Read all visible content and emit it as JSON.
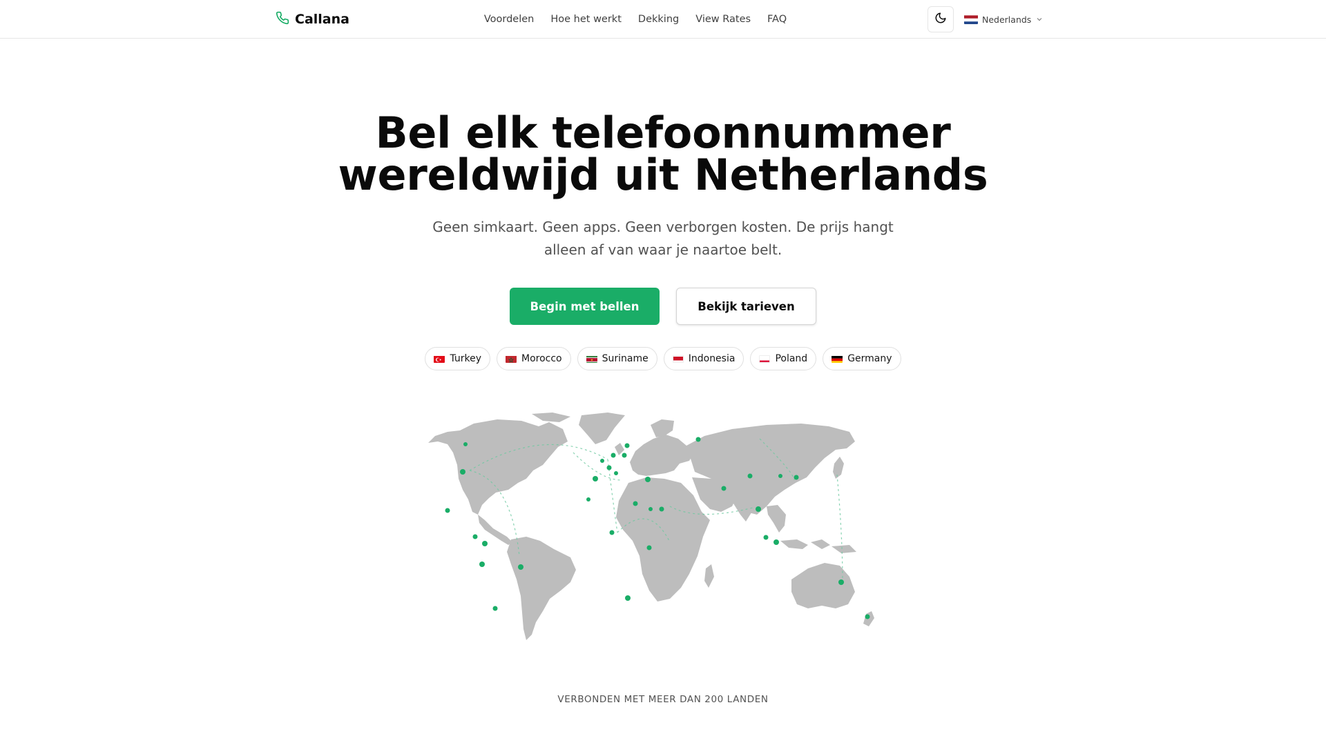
{
  "header": {
    "brand": "Callana",
    "nav": [
      "Voordelen",
      "Hoe het werkt",
      "Dekking",
      "View Rates",
      "FAQ"
    ],
    "language": "Nederlands"
  },
  "hero": {
    "title_line1": "Bel elk telefoonnummer",
    "title_line2": "wereldwijd uit Netherlands",
    "subtitle_line1": "Geen simkaart. Geen apps. Geen verborgen kosten. De prijs hangt",
    "subtitle_line2": "alleen af van waar je naartoe belt.",
    "primary_cta": "Begin met bellen",
    "secondary_cta": "Bekijk tarieven"
  },
  "countries": [
    "Turkey",
    "Morocco",
    "Suriname",
    "Indonesia",
    "Poland",
    "Germany"
  ],
  "footer_label": "VERBONDEN MET MEER DAN 200 LANDEN",
  "colors": {
    "accent": "#1aad67",
    "map_land": "#bdbdbd",
    "text_muted": "#525252"
  },
  "icons": {
    "logo": "phone-icon",
    "theme": "moon-icon",
    "language_flag": "netherlands-flag-icon",
    "language_chevron": "chevron-down-icon"
  }
}
